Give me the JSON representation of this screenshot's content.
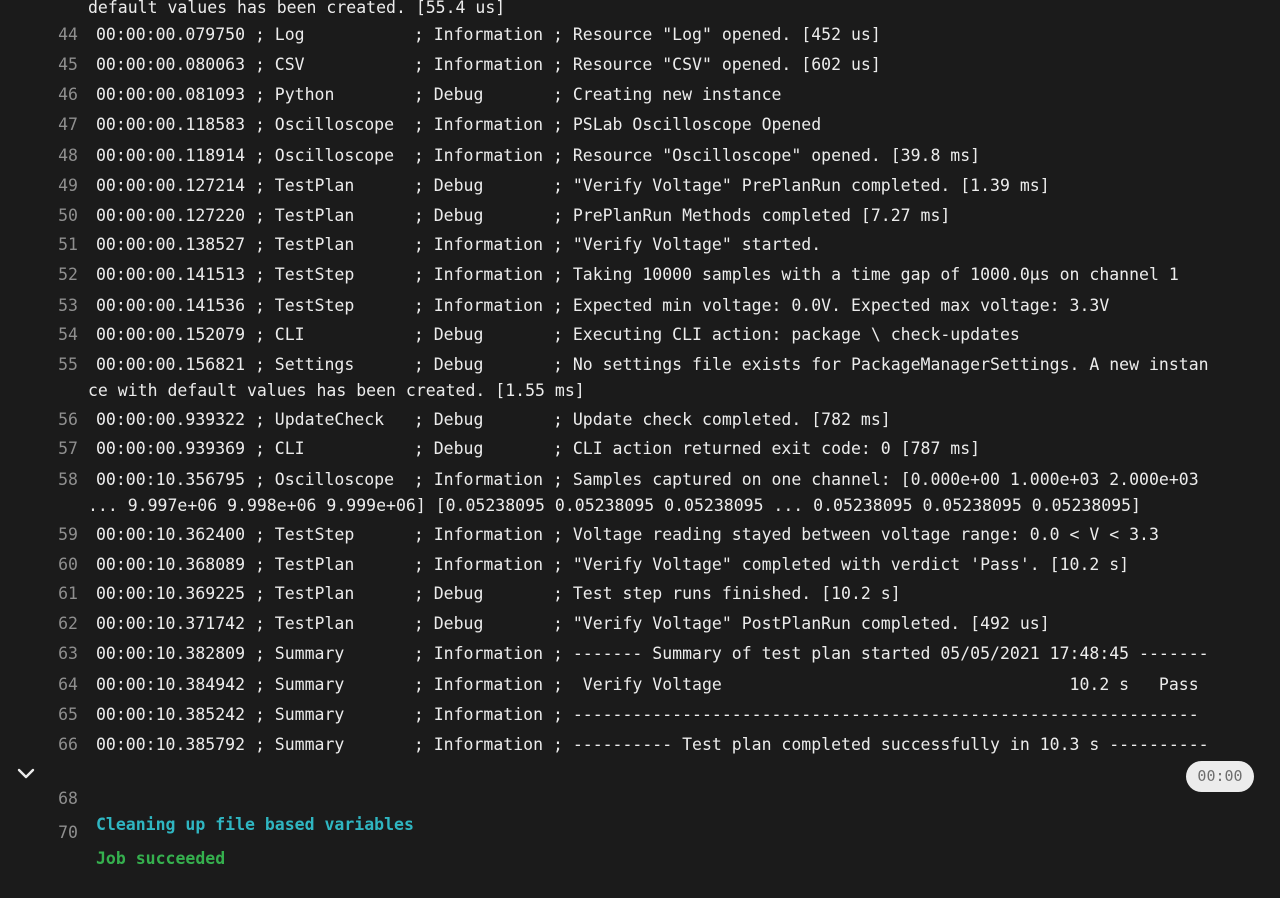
{
  "header_fragment": "default values has been created. [55.4 us]",
  "lines": [
    {
      "num": "44",
      "text": "00:00:00.079750 ; Log           ; Information ; Resource \"Log\" opened. [452 us]"
    },
    {
      "num": "45",
      "text": "00:00:00.080063 ; CSV           ; Information ; Resource \"CSV\" opened. [602 us]"
    },
    {
      "num": "46",
      "text": "00:00:00.081093 ; Python        ; Debug       ; Creating new instance"
    },
    {
      "num": "47",
      "text": "00:00:00.118583 ; Oscilloscope  ; Information ; PSLab Oscilloscope Opened"
    },
    {
      "num": "48",
      "text": "00:00:00.118914 ; Oscilloscope  ; Information ; Resource \"Oscilloscope\" opened. [39.8 ms]"
    },
    {
      "num": "49",
      "text": "00:00:00.127214 ; TestPlan      ; Debug       ; \"Verify Voltage\" PrePlanRun completed. [1.39 ms]"
    },
    {
      "num": "50",
      "text": "00:00:00.127220 ; TestPlan      ; Debug       ; PrePlanRun Methods completed [7.27 ms]"
    },
    {
      "num": "51",
      "text": "00:00:00.138527 ; TestPlan      ; Information ; \"Verify Voltage\" started."
    },
    {
      "num": "52",
      "text": "00:00:00.141513 ; TestStep      ; Information ; Taking 10000 samples with a time gap of 1000.0µs on channel 1"
    },
    {
      "num": "53",
      "text": "00:00:00.141536 ; TestStep      ; Information ; Expected min voltage: 0.0V. Expected max voltage: 3.3V"
    },
    {
      "num": "54",
      "text": "00:00:00.152079 ; CLI           ; Debug       ; Executing CLI action: package \\ check-updates"
    },
    {
      "num": "55",
      "text": "00:00:00.156821 ; Settings      ; Debug       ; No settings file exists for PackageManagerSettings. A new instan",
      "cont": "ce with default values has been created. [1.55 ms]"
    },
    {
      "num": "56",
      "text": "00:00:00.939322 ; UpdateCheck   ; Debug       ; Update check completed. [782 ms]"
    },
    {
      "num": "57",
      "text": "00:00:00.939369 ; CLI           ; Debug       ; CLI action returned exit code: 0 [787 ms]"
    },
    {
      "num": "58",
      "text": "00:00:10.356795 ; Oscilloscope  ; Information ; Samples captured on one channel: [0.000e+00 1.000e+03 2.000e+03",
      "cont": "... 9.997e+06 9.998e+06 9.999e+06] [0.05238095 0.05238095 0.05238095 ... 0.05238095 0.05238095 0.05238095]"
    },
    {
      "num": "59",
      "text": "00:00:10.362400 ; TestStep      ; Information ; Voltage reading stayed between voltage range: 0.0 < V < 3.3"
    },
    {
      "num": "60",
      "text": "00:00:10.368089 ; TestPlan      ; Information ; \"Verify Voltage\" completed with verdict 'Pass'. [10.2 s]"
    },
    {
      "num": "61",
      "text": "00:00:10.369225 ; TestPlan      ; Debug       ; Test step runs finished. [10.2 s]"
    },
    {
      "num": "62",
      "text": "00:00:10.371742 ; TestPlan      ; Debug       ; \"Verify Voltage\" PostPlanRun completed. [492 us]"
    },
    {
      "num": "63",
      "text": "00:00:10.382809 ; Summary       ; Information ; ------- Summary of test plan started 05/05/2021 17:48:45 -------"
    },
    {
      "num": "64",
      "text": "00:00:10.384942 ; Summary       ; Information ;  Verify Voltage                                   10.2 s   Pass"
    },
    {
      "num": "65",
      "text": "00:00:10.385242 ; Summary       ; Information ; ---------------------------------------------------------------"
    },
    {
      "num": "66",
      "text": "00:00:10.385792 ; Summary       ; Information ; ---------- Test plan completed successfully in 10.3 s ----------"
    }
  ],
  "section": {
    "num": "68",
    "text": "Cleaning up file based variables",
    "duration": "00:00",
    "icon": "chevron-down-icon"
  },
  "result": {
    "num": "70",
    "text": "Job succeeded"
  },
  "colors": {
    "background": "#1b1b1b",
    "section": "#2fb6c2",
    "success": "#35b04e",
    "line_number": "#8f8f8f"
  }
}
